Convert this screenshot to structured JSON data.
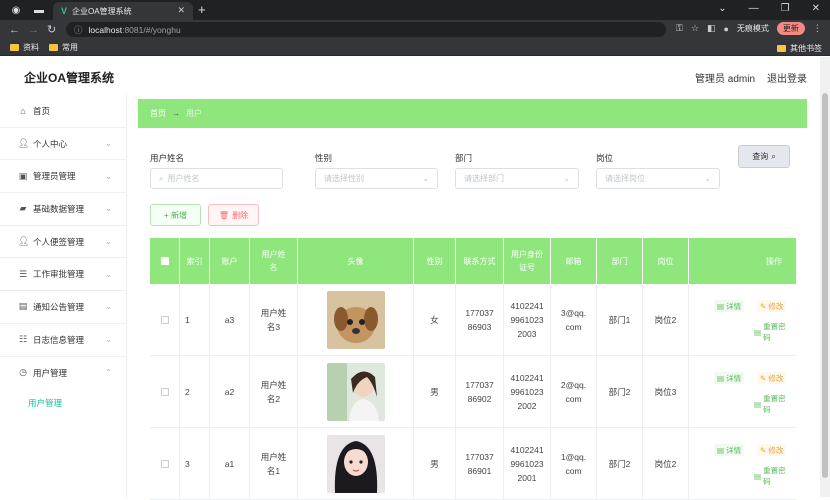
{
  "browser": {
    "tab_title": "企业OA管理系统",
    "url_host": "localhost",
    "url_rest": ":8081/#/yonghu",
    "incognito_label": "无痕模式",
    "update_label": "更新",
    "bookmarks": [
      "资料",
      "常用"
    ],
    "other_bookmarks": "其他书签"
  },
  "header": {
    "title": "企业OA管理系统",
    "user": "管理员 admin",
    "logout": "退出登录"
  },
  "sidebar": {
    "items": [
      {
        "label": "首页",
        "icon": "home-icon"
      },
      {
        "label": "个人中心",
        "icon": "user-icon"
      },
      {
        "label": "管理员管理",
        "icon": "briefcase-icon"
      },
      {
        "label": "基础数据管理",
        "icon": "truck-icon"
      },
      {
        "label": "个人便签管理",
        "icon": "user-icon"
      },
      {
        "label": "工作审批管理",
        "icon": "list-icon"
      },
      {
        "label": "通知公告管理",
        "icon": "clipboard-icon"
      },
      {
        "label": "日志信息管理",
        "icon": "sliders-icon"
      },
      {
        "label": "用户管理",
        "icon": "clock-icon"
      }
    ],
    "submenu": "用户管理"
  },
  "breadcrumb": {
    "home": "首页",
    "arrow": "→",
    "current": "用户"
  },
  "search": {
    "name_label": "用户姓名",
    "name_placeholder": "用户姓名",
    "sex_label": "性别",
    "sex_placeholder": "请选择性别",
    "dept_label": "部门",
    "dept_placeholder": "请选择部门",
    "post_label": "岗位",
    "post_placeholder": "请选择岗位",
    "query": "查询"
  },
  "actions": {
    "add": "+ 新增",
    "delete": "删除"
  },
  "table": {
    "headers": [
      "索引",
      "账户",
      "用户姓名",
      "头像",
      "性别",
      "联系方式",
      "用户身份证号",
      "邮箱",
      "部门",
      "岗位",
      "操作"
    ],
    "op_detail": "详情",
    "op_edit": "修改",
    "op_reset": "重置密码",
    "rows": [
      {
        "index": "1",
        "account": "a3",
        "name": "用户姓名3",
        "sex": "女",
        "phone": "17703786903",
        "idcard": "410224199610232003",
        "email": "3@qq.com",
        "dept": "部门1",
        "post": "岗位2"
      },
      {
        "index": "2",
        "account": "a2",
        "name": "用户姓名2",
        "sex": "男",
        "phone": "17703786902",
        "idcard": "410224199610232002",
        "email": "2@qq.com",
        "dept": "部门2",
        "post": "岗位3"
      },
      {
        "index": "3",
        "account": "a1",
        "name": "用户姓名1",
        "sex": "男",
        "phone": "17703786901",
        "idcard": "410224199610232001",
        "email": "1@qq.com",
        "dept": "部门2",
        "post": "岗位2"
      }
    ]
  },
  "colors": {
    "accent": "#8ee67d",
    "submenu": "#16c2a3"
  }
}
